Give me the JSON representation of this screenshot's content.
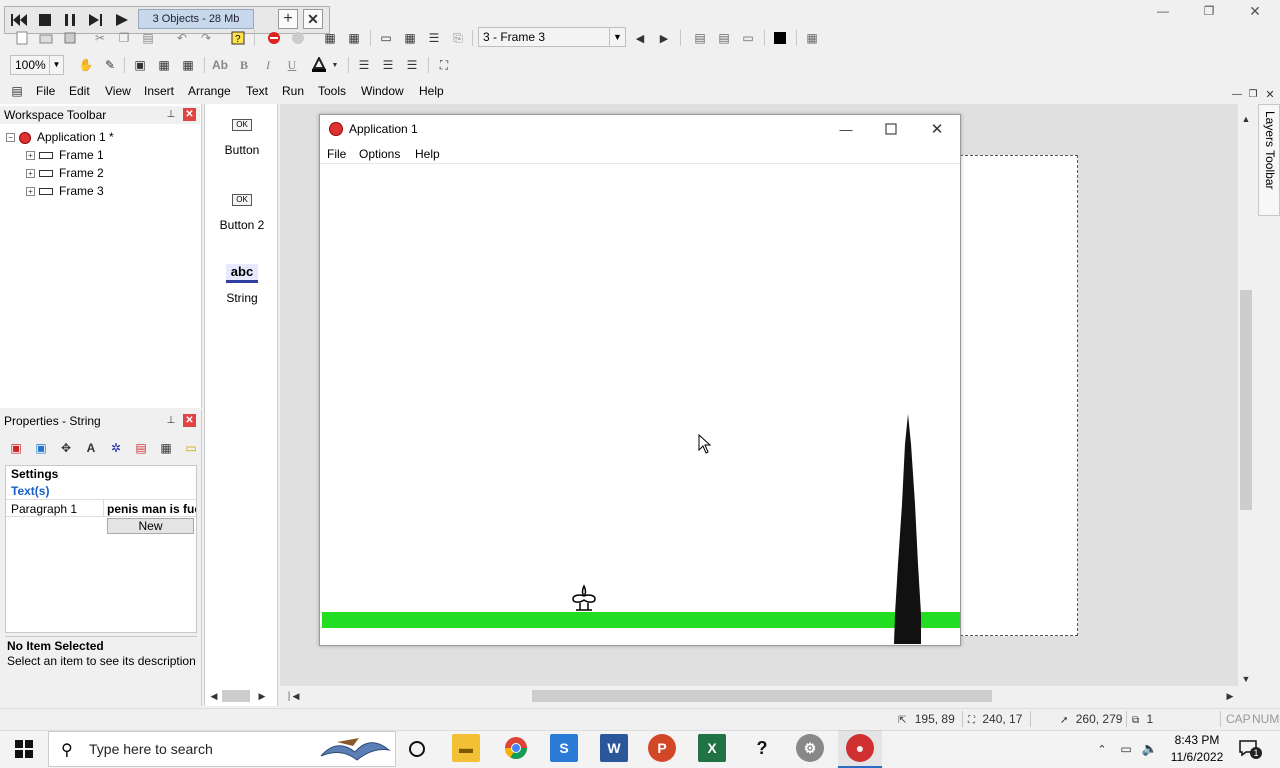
{
  "media_bar": {
    "label": "3 Objects - 28 Mb"
  },
  "window_controls": {
    "minimize": "—",
    "restore": "❐",
    "close": "✕"
  },
  "toolbar": {
    "frame_select": "3 - Frame 3",
    "zoom": "100%",
    "bold": "B",
    "italic": "I",
    "underline": "U"
  },
  "menu": {
    "items": [
      "File",
      "Edit",
      "View",
      "Insert",
      "Arrange",
      "Text",
      "Run",
      "Tools",
      "Window",
      "Help"
    ]
  },
  "workspace": {
    "title": "Workspace Toolbar",
    "tree": [
      "Application 1 *",
      "Frame 1",
      "Frame 2",
      "Frame 3"
    ]
  },
  "objects": {
    "items": [
      {
        "icon_text": "OK",
        "label": "Button"
      },
      {
        "icon_text": "OK",
        "label": "Button 2"
      },
      {
        "icon_text": "abc",
        "label": "String"
      }
    ]
  },
  "properties": {
    "title": "Properties - String",
    "settings": "Settings",
    "texts": "Text(s)",
    "param_label": "Paragraph 1",
    "param_value": "penis man is fuc",
    "new_button": "New",
    "desc_title": "No Item Selected",
    "desc_text": "Select an item to see its description"
  },
  "app_window": {
    "title": "Application 1",
    "menu": [
      "File",
      "Options",
      "Help"
    ],
    "colors": {
      "ground": "#22dd22",
      "tree": "#111111"
    }
  },
  "layers_toolbar": {
    "label": "Layers Toolbar"
  },
  "status_bar": {
    "pos1": "195, 89",
    "size": "240, 17",
    "pos2": "260, 279",
    "count": "1",
    "caps": "CAP",
    "num": "NUM"
  },
  "taskbar": {
    "search_placeholder": "Type here to search",
    "time": "8:43 PM",
    "date": "11/6/2022",
    "notif_count": "1"
  }
}
